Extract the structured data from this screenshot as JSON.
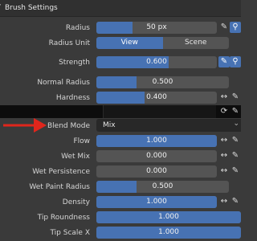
{
  "panel": {
    "title": "Brush Settings"
  },
  "rows": {
    "radius": {
      "label": "Radius",
      "value": "50 px",
      "fill": 0.3
    },
    "radius_unit": {
      "label": "Radius Unit",
      "options": [
        "View",
        "Scene"
      ],
      "selected": "View"
    },
    "strength": {
      "label": "Strength",
      "value": "0.600",
      "fill": 0.6
    },
    "normal_radius": {
      "label": "Normal Radius",
      "value": "0.500",
      "fill": 0.3
    },
    "hardness": {
      "label": "Hardness",
      "value": "0.400",
      "fill": 0.4
    },
    "blend_mode": {
      "label": "Blend Mode",
      "value": "Mix"
    },
    "flow": {
      "label": "Flow",
      "value": "1.000",
      "fill": 1.0
    },
    "wet_mix": {
      "label": "Wet Mix",
      "value": "0.000",
      "fill": 0.0
    },
    "wet_persistence": {
      "label": "Wet Persistence",
      "value": "0.000",
      "fill": 0.0
    },
    "wet_paint_radius": {
      "label": "Wet Paint Radius",
      "value": "0.500",
      "fill": 0.3
    },
    "density": {
      "label": "Density",
      "value": "1.000",
      "fill": 1.0
    },
    "tip_roundness": {
      "label": "Tip Roundness",
      "value": "1.000",
      "fill": 1.0
    },
    "tip_scale_x": {
      "label": "Tip Scale X",
      "value": "1.000",
      "fill": 1.0
    }
  },
  "colors": {
    "accent": "#4772b3",
    "field": "#545454",
    "panel": "#3a3a3a",
    "annotation": "#e0261c"
  }
}
